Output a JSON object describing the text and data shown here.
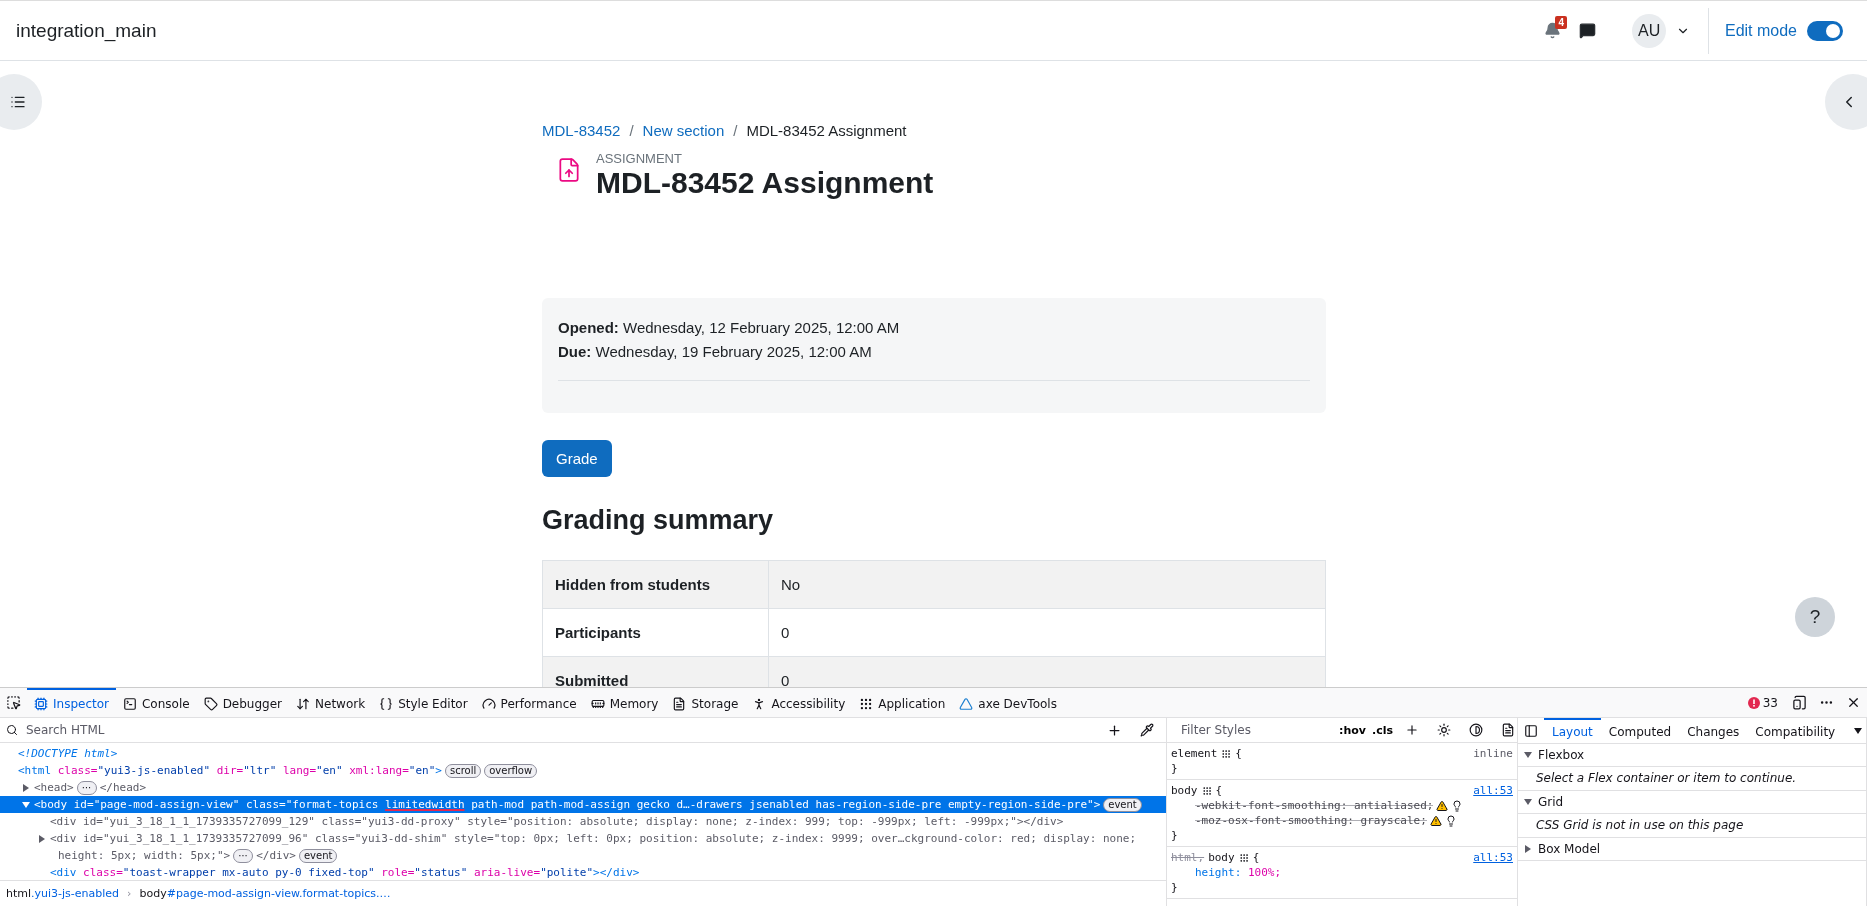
{
  "navbar": {
    "site_name": "integration_main",
    "notifications": {
      "count": "4"
    },
    "avatar": "AU",
    "edit_mode": {
      "label": "Edit mode",
      "on": true
    }
  },
  "page": {
    "breadcrumb_separator": "/",
    "breadcrumbs": [
      {
        "text": "MDL-83452",
        "link": true
      },
      {
        "text": "New section",
        "link": true
      },
      {
        "text": "MDL-83452 Assignment",
        "link": false
      }
    ],
    "activity_type": "ASSIGNMENT",
    "title": "MDL-83452 Assignment",
    "dates": [
      "**Opened:** Wednesday, 12 February 2025, 12:00 AM",
      "**Due:** Wednesday, 19 February 2025, 12:00 AM"
    ],
    "grade_button": "Grade",
    "summary_heading": "Grading summary",
    "summary_rows": [
      {
        "label": "Hidden from students",
        "value": "No"
      },
      {
        "label": "Participants",
        "value": "0"
      },
      {
        "label": "Submitted",
        "value": "0"
      }
    ],
    "help_button": "?"
  },
  "devtools": {
    "tabs": [
      {
        "label": "Inspector",
        "selected": true
      },
      {
        "label": "Console",
        "selected": false
      },
      {
        "label": "Debugger",
        "selected": false
      },
      {
        "label": "Network",
        "selected": false
      },
      {
        "label": "Style Editor",
        "selected": false
      },
      {
        "label": "Performance",
        "selected": false
      },
      {
        "label": "Memory",
        "selected": false
      },
      {
        "label": "Storage",
        "selected": false
      },
      {
        "label": "Accessibility",
        "selected": false
      },
      {
        "label": "Application",
        "selected": false
      },
      {
        "label": "axe DevTools",
        "selected": false
      }
    ],
    "error_count": "33",
    "search_placeholder": "Search HTML",
    "tree": [
      {
        "selected": false,
        "lines": [
          [
            {
              "kind": "code",
              "parts": [
                {
                  "kind": "comment",
                  "text": "<!DOCTYPE html>"
                }
              ]
            }
          ]
        ]
      },
      {
        "selected": false,
        "lines": [
          [
            {
              "kind": "code",
              "parts": [
                {
                  "kind": "tag",
                  "text": "<html"
                },
                {
                  "kind": "attr",
                  "text": " class="
                },
                {
                  "kind": "value",
                  "text": "\"yui3-js-enabled\""
                },
                {
                  "kind": "attr",
                  "text": " dir="
                },
                {
                  "kind": "value",
                  "text": "\"ltr\""
                },
                {
                  "kind": "attr",
                  "text": " lang="
                },
                {
                  "kind": "value",
                  "text": "\"en\""
                },
                {
                  "kind": "attr",
                  "text": " xml:lang="
                },
                {
                  "kind": "value",
                  "text": "\"en\""
                },
                {
                  "kind": "tag",
                  "text": ">"
                }
              ]
            },
            {
              "kind": "badge",
              "text": "scroll"
            },
            {
              "kind": "badge",
              "text": "overflow"
            }
          ]
        ],
        "children": [
          {
            "selected": false,
            "expanded": false,
            "lines": [
              [
                {
                  "kind": "code",
                  "parts": [
                    {
                      "kind": "dim",
                      "text": "<head>"
                    }
                  ]
                },
                {
                  "kind": "badge",
                  "text": "⋯"
                },
                {
                  "kind": "code",
                  "parts": [
                    {
                      "kind": "dim",
                      "text": "</head>"
                    }
                  ]
                }
              ]
            ]
          },
          {
            "selected": true,
            "expanded": true,
            "lines": [
              [
                {
                  "kind": "code",
                  "parts": [
                    {
                      "kind": "tag",
                      "text": "<body"
                    },
                    {
                      "kind": "attr",
                      "text": " id="
                    },
                    {
                      "kind": "value",
                      "text": "\"page-mod-assign-view\""
                    },
                    {
                      "kind": "attr",
                      "text": " class="
                    },
                    {
                      "kind": "value",
                      "text": "\"format-topics "
                    },
                    {
                      "kind": "underlined",
                      "text": "limitedwidth"
                    },
                    {
                      "kind": "value",
                      "text": " path-mod path-mod-assign gecko d…-drawers jsenabled has-region-side-pre empty-region-side-pre\""
                    },
                    {
                      "kind": "tag",
                      "text": ">"
                    }
                  ]
                },
                {
                  "kind": "badge",
                  "text": "event"
                }
              ]
            ],
            "children": [
              {
                "selected": false,
                "lines": [
                  [
                    {
                      "kind": "code",
                      "parts": [
                        {
                          "kind": "dim",
                          "text": "<div id=\"yui_3_18_1_1_1739335727099_129\" class=\"yui3-dd-proxy\" style=\"position: absolute; display: none; z-index: 999; top: -999px; left: -999px;\"></div>"
                        }
                      ]
                    }
                  ]
                ]
              },
              {
                "selected": false,
                "expanded": false,
                "lines": [
                  [
                    {
                      "kind": "code",
                      "parts": [
                        {
                          "kind": "dim",
                          "text": "<div id=\"yui_3_18_1_1_1739335727099_96\" class=\"yui3-dd-shim\" style=\"top: 0px; left: 0px; position: absolute; z-index: 9999; over…ckground-color: red; display: none;"
                        }
                      ]
                    }
                  ],
                  [
                    {
                      "kind": "code",
                      "parts": [
                        {
                          "kind": "dim",
                          "text": "height: 5px; width: 5px;\">"
                        }
                      ]
                    },
                    {
                      "kind": "badge",
                      "text": "⋯"
                    },
                    {
                      "kind": "code",
                      "parts": [
                        {
                          "kind": "dim",
                          "text": "</div>"
                        }
                      ]
                    },
                    {
                      "kind": "badge",
                      "text": "event"
                    }
                  ]
                ]
              },
              {
                "selected": false,
                "lines": [
                  [
                    {
                      "kind": "code",
                      "parts": [
                        {
                          "kind": "tag",
                          "text": "<div"
                        },
                        {
                          "kind": "attr",
                          "text": " class="
                        },
                        {
                          "kind": "value",
                          "text": "\"toast-wrapper mx-auto py-0 fixed-top\""
                        },
                        {
                          "kind": "attr",
                          "text": " role="
                        },
                        {
                          "kind": "value",
                          "text": "\"status\""
                        },
                        {
                          "kind": "attr",
                          "text": " aria-live="
                        },
                        {
                          "kind": "value",
                          "text": "\"polite\""
                        },
                        {
                          "kind": "tag",
                          "text": "></div>"
                        }
                      ]
                    }
                  ]
                ]
              }
            ]
          }
        ]
      }
    ],
    "breadcrumb_separator": "›",
    "breadcrumbs": [
      {
        "tag": "html",
        "rest": ".yui3-js-enabled"
      },
      {
        "tag": "body",
        "rest": "#page-mod-assign-view.format-topics.…"
      }
    ],
    "styles": {
      "filter_placeholder": "Filter Styles",
      "toggles": [
        ":hov",
        ".cls"
      ],
      "rules": [
        {
          "selector": [
            {
              "text": "element",
              "matched": true
            }
          ],
          "open_brace": "{",
          "close_brace": "}",
          "source": "inline",
          "source_link": false
        },
        {
          "selector": [
            {
              "text": "body",
              "matched": true
            }
          ],
          "open_brace": "{",
          "close_brace": "}",
          "source": "all:53",
          "source_link": true,
          "declarations": [
            {
              "prop": "-webkit-font-smoothing:",
              "value": "antialiased;",
              "overridden": true,
              "warning": true
            },
            {
              "prop": "-moz-osx-font-smoothing:",
              "value": "grayscale;",
              "overridden": true,
              "warning": true
            }
          ]
        },
        {
          "selector": [
            {
              "text": "html,",
              "matched": false
            },
            {
              "text": "body",
              "matched": true
            }
          ],
          "open_brace": "{",
          "close_brace": "}",
          "source": "all:53",
          "source_link": true,
          "declarations": [
            {
              "prop": "height:",
              "value": "100%;",
              "overridden": false,
              "warning": false
            }
          ]
        }
      ]
    },
    "layout": {
      "tabs": [
        {
          "label": "Layout",
          "selected": true
        },
        {
          "label": "Computed",
          "selected": false
        },
        {
          "label": "Changes",
          "selected": false
        },
        {
          "label": "Compatibility",
          "selected": false
        }
      ],
      "sections": [
        {
          "title": "Flexbox",
          "expanded": true,
          "message": "Select a Flex container or item to continue."
        },
        {
          "title": "Grid",
          "expanded": true,
          "message": "CSS Grid is not in use on this page"
        },
        {
          "title": "Box Model",
          "expanded": false
        }
      ]
    }
  }
}
